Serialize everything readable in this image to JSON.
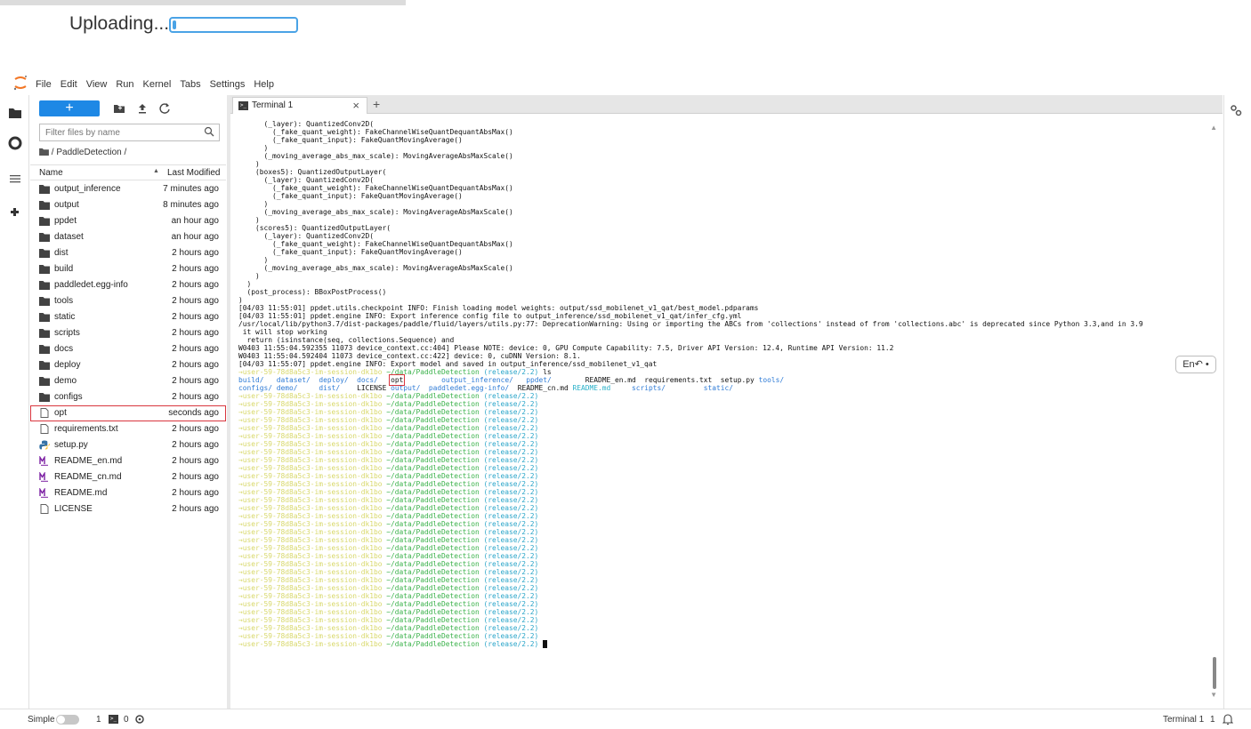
{
  "upload": {
    "label": "Uploading...",
    "progress": 0.03
  },
  "menubar": {
    "items": [
      "File",
      "Edit",
      "View",
      "Run",
      "Kernel",
      "Tabs",
      "Settings",
      "Help"
    ]
  },
  "filebrowser": {
    "new_label": "+",
    "filter_placeholder": "Filter files by name",
    "breadcrumb": "/ PaddleDetection /",
    "col_name": "Name",
    "col_modified": "Last Modified",
    "files": [
      {
        "name": "output_inference",
        "modified": "7 minutes ago",
        "type": "folder"
      },
      {
        "name": "output",
        "modified": "8 minutes ago",
        "type": "folder"
      },
      {
        "name": "ppdet",
        "modified": "an hour ago",
        "type": "folder"
      },
      {
        "name": "dataset",
        "modified": "an hour ago",
        "type": "folder"
      },
      {
        "name": "dist",
        "modified": "2 hours ago",
        "type": "folder"
      },
      {
        "name": "build",
        "modified": "2 hours ago",
        "type": "folder"
      },
      {
        "name": "paddledet.egg-info",
        "modified": "2 hours ago",
        "type": "folder"
      },
      {
        "name": "tools",
        "modified": "2 hours ago",
        "type": "folder"
      },
      {
        "name": "static",
        "modified": "2 hours ago",
        "type": "folder"
      },
      {
        "name": "scripts",
        "modified": "2 hours ago",
        "type": "folder"
      },
      {
        "name": "docs",
        "modified": "2 hours ago",
        "type": "folder"
      },
      {
        "name": "deploy",
        "modified": "2 hours ago",
        "type": "folder"
      },
      {
        "name": "demo",
        "modified": "2 hours ago",
        "type": "folder"
      },
      {
        "name": "configs",
        "modified": "2 hours ago",
        "type": "folder"
      },
      {
        "name": "opt",
        "modified": "seconds ago",
        "type": "file",
        "highlighted": true
      },
      {
        "name": "requirements.txt",
        "modified": "2 hours ago",
        "type": "file"
      },
      {
        "name": "setup.py",
        "modified": "2 hours ago",
        "type": "python"
      },
      {
        "name": "README_en.md",
        "modified": "2 hours ago",
        "type": "markdown"
      },
      {
        "name": "README_cn.md",
        "modified": "2 hours ago",
        "type": "markdown"
      },
      {
        "name": "README.md",
        "modified": "2 hours ago",
        "type": "markdown"
      },
      {
        "name": "LICENSE",
        "modified": "2 hours ago",
        "type": "file"
      }
    ]
  },
  "tabs": [
    {
      "label": "Terminal 1",
      "close": "×"
    }
  ],
  "tab_add": "+",
  "terminal": {
    "output_lines": [
      "      (_layer): QuantizedConv2D(",
      "        (_fake_quant_weight): FakeChannelWiseQuantDequantAbsMax()",
      "        (_fake_quant_input): FakeQuantMovingAverage()",
      "      )",
      "      (_moving_average_abs_max_scale): MovingAverageAbsMaxScale()",
      "    )",
      "    (boxes5): QuantizedOutputLayer(",
      "      (_layer): QuantizedConv2D(",
      "        (_fake_quant_weight): FakeChannelWiseQuantDequantAbsMax()",
      "        (_fake_quant_input): FakeQuantMovingAverage()",
      "      )",
      "      (_moving_average_abs_max_scale): MovingAverageAbsMaxScale()",
      "    )",
      "    (scores5): QuantizedOutputLayer(",
      "      (_layer): QuantizedConv2D(",
      "        (_fake_quant_weight): FakeChannelWiseQuantDequantAbsMax()",
      "        (_fake_quant_input): FakeQuantMovingAverage()",
      "      )",
      "      (_moving_average_abs_max_scale): MovingAverageAbsMaxScale()",
      "    )",
      "  )",
      "  (post_process): BBoxPostProcess()",
      ")",
      "[04/03 11:55:01] ppdet.utils.checkpoint INFO: Finish loading model weights: output/ssd_mobilenet_v1_qat/best_model.pdparams",
      "[04/03 11:55:01] ppdet.engine INFO: Export inference config file to output_inference/ssd_mobilenet_v1_qat/infer_cfg.yml",
      "/usr/local/lib/python3.7/dist-packages/paddle/fluid/layers/utils.py:77: DeprecationWarning: Using or importing the ABCs from 'collections' instead of from 'collections.abc' is deprecated since Python 3.3,and in 3.9",
      " it will stop working",
      "  return (isinstance(seq, collections.Sequence) and",
      "W0403 11:55:04.592355 11073 device_context.cc:404] Please NOTE: device: 0, GPU Compute Capability: 7.5, Driver API Version: 12.4, Runtime API Version: 11.2",
      "W0403 11:55:04.592404 11073 device_context.cc:422] device: 0, cuDNN Version: 8.1.",
      "[04/03 11:55:07] ppdet.engine INFO: Export model and saved in output_inference/ssd_mobilenet_v1_qat"
    ],
    "prompt": {
      "user": "→user-59-78d8a5c3-im-session-dk1bo",
      "path": " ~/data/PaddleDetection",
      "branch": " (release/2.2)"
    },
    "ls_command": " ls",
    "ls_row1": [
      {
        "text": "build/",
        "cls": "ls-dir",
        "pad": 3
      },
      {
        "text": "dataset/",
        "cls": "ls-dir",
        "pad": 2
      },
      {
        "text": "deploy/",
        "cls": "ls-dir",
        "pad": 2
      },
      {
        "text": "docs/",
        "cls": "ls-dir",
        "pad": 3
      },
      {
        "text": "opt",
        "cls": "",
        "pad": 9,
        "box": true
      },
      {
        "text": "output_inference/",
        "cls": "ls-dir",
        "pad": 3
      },
      {
        "text": "ppdet/",
        "cls": "ls-dir",
        "pad": 8
      },
      {
        "text": "README_en.md",
        "cls": "",
        "pad": 2
      },
      {
        "text": "requirements.txt",
        "cls": "",
        "pad": 2
      },
      {
        "text": "setup.py",
        "cls": "",
        "pad": 1
      },
      {
        "text": "tools/",
        "cls": "ls-dir",
        "pad": 0
      }
    ],
    "ls_row2": [
      {
        "text": "configs/",
        "cls": "ls-dir",
        "pad": 1
      },
      {
        "text": "demo/",
        "cls": "ls-dir",
        "pad": 5
      },
      {
        "text": "dist/",
        "cls": "ls-dir",
        "pad": 4
      },
      {
        "text": "LICENSE",
        "cls": "",
        "pad": 1
      },
      {
        "text": "output/",
        "cls": "ls-dir",
        "pad": 2
      },
      {
        "text": "paddledet.egg-info/",
        "cls": "ls-dir",
        "pad": 2
      },
      {
        "text": "README_cn.md",
        "cls": "",
        "pad": 1
      },
      {
        "text": "README.md",
        "cls": "ls-cyan",
        "pad": 5
      },
      {
        "text": "scripts/",
        "cls": "ls-dir",
        "pad": 9
      },
      {
        "text": "static/",
        "cls": "ls-dir",
        "pad": 0
      }
    ],
    "empty_prompt_count": 32
  },
  "input_indicator": "En↶ •",
  "statusbar": {
    "mode_label": "Simple",
    "terminal_count": "1",
    "kernel_count": "0",
    "terminal_status": "Terminal 1",
    "terminal_status_num": "1"
  }
}
